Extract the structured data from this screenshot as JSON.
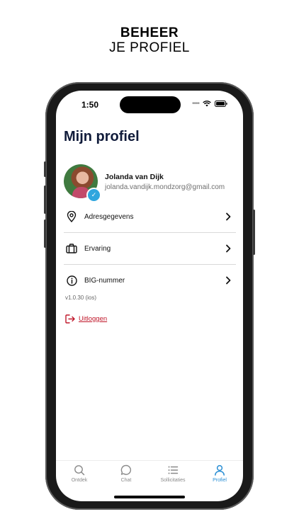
{
  "headline": {
    "line1": "BEHEER",
    "line2": "JE PROFIEL"
  },
  "status_bar": {
    "time": "1:50"
  },
  "page": {
    "title": "Mijn profiel"
  },
  "profile": {
    "name": "Jolanda van Dijk",
    "email": "jolanda.vandijk.mondzorg@gmail.com"
  },
  "menu": [
    {
      "label": "Adresgegevens",
      "icon": "location-pin-icon"
    },
    {
      "label": "Ervaring",
      "icon": "briefcase-icon"
    },
    {
      "label": "BIG-nummer",
      "icon": "info-icon"
    }
  ],
  "version": "v1.0.30 (ios)",
  "logout": {
    "label": "Uitloggen"
  },
  "tabbar": {
    "tabs": [
      {
        "label": "Ontdek",
        "icon": "search-icon",
        "active": false
      },
      {
        "label": "Chat",
        "icon": "chat-bubble-icon",
        "active": false
      },
      {
        "label": "Sollicitaties",
        "icon": "list-icon",
        "active": false
      },
      {
        "label": "Profiel",
        "icon": "user-icon",
        "active": true
      }
    ]
  },
  "colors": {
    "accent": "#2b8fd4",
    "logout": "#c0182b",
    "title": "#101b3a"
  }
}
